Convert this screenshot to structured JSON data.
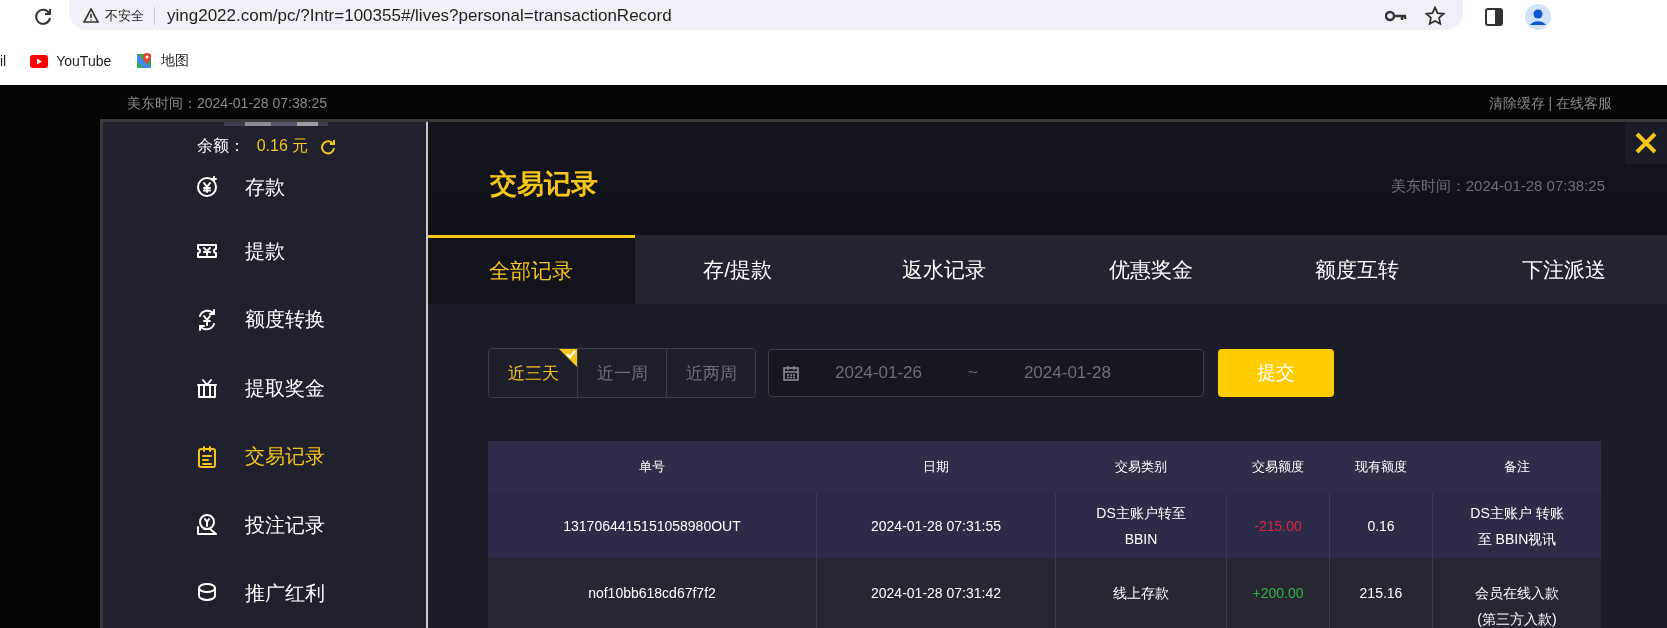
{
  "browser": {
    "security_label": "不安全",
    "url": "ying2022.com/pc/?Intr=100355#/lives?personal=transactionRecord",
    "bookmarks": [
      {
        "kind": "cut",
        "label": "il"
      },
      {
        "kind": "video",
        "label": "YouTube"
      },
      {
        "kind": "map",
        "label": "地图"
      }
    ]
  },
  "page_header": {
    "time": "美东时间：2024-01-28 07:38:25",
    "links": "清除缓存 | 在线客服"
  },
  "sidebar": {
    "balance_label": "余额：",
    "balance": "0.16 元",
    "items": [
      {
        "kind": "deposit",
        "label": "存款",
        "selected": false
      },
      {
        "kind": "withdraw",
        "label": "提款",
        "selected": false
      },
      {
        "kind": "transfer",
        "label": "额度转换",
        "selected": false
      },
      {
        "kind": "gift",
        "label": "提取奖金",
        "selected": false
      },
      {
        "kind": "records",
        "label": "交易记录",
        "selected": true
      },
      {
        "kind": "bets",
        "label": "投注记录",
        "selected": false
      },
      {
        "kind": "promo",
        "label": "推广红利",
        "selected": false
      }
    ]
  },
  "main": {
    "title": "交易记录",
    "time": "美东时间：2024-01-28 07:38:25",
    "tabs": [
      {
        "label": "全部记录",
        "selected": true
      },
      {
        "label": "存/提款",
        "selected": false
      },
      {
        "label": "返水记录",
        "selected": false
      },
      {
        "label": "优惠奖金",
        "selected": false
      },
      {
        "label": "额度互转",
        "selected": false
      },
      {
        "label": "下注派送",
        "selected": false
      }
    ],
    "ranges": [
      {
        "label": "近三天",
        "selected": true
      },
      {
        "label": "近一周",
        "selected": false
      },
      {
        "label": "近两周",
        "selected": false
      }
    ],
    "date_from": "2024-01-26",
    "date_separator": "~",
    "date_to": "2024-01-28",
    "submit": "提交",
    "table": {
      "columns": [
        "单号",
        "日期",
        "交易类别",
        "交易额度",
        "现有额度",
        "备注"
      ],
      "rows": [
        {
          "cells": [
            "1317064415151058980OUT",
            "2024-01-28 07:31:55",
            "DS主账户转至BBIN",
            "-215.00",
            "0.16",
            "DS主账户 转账至 BBIN视讯"
          ],
          "color": "#d9263d"
        },
        {
          "cells": [
            "nof10bb618cd67f7f2",
            "2024-01-28 07:31:42",
            "线上存款",
            "+200.00",
            "215.16",
            "会员在线入款(第三方入款)"
          ],
          "color": "#2fb344"
        }
      ]
    }
  }
}
